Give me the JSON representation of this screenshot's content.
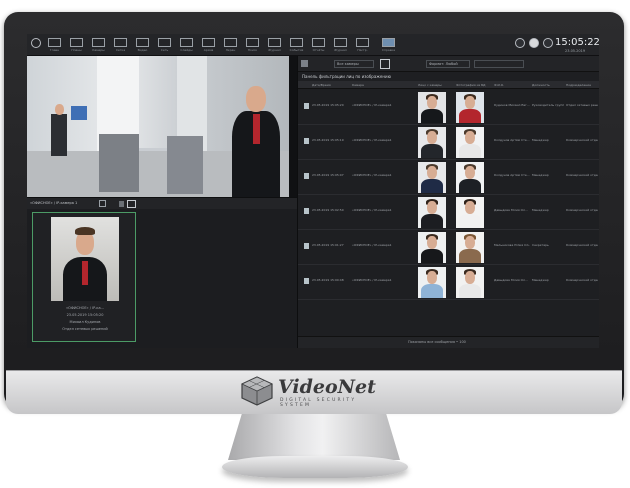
{
  "toolbar": {
    "buttons": [
      "Главн",
      "Планы",
      "Камеры",
      "Сетка",
      "Видео",
      "Сеть",
      "Слайды",
      "Архив",
      "Экран",
      "Поиск",
      "Журнал",
      "События",
      "Отчёты",
      "Журнал",
      "Настр.",
      "Справка"
    ],
    "clock": "15:05:22",
    "date": "23.05.2019"
  },
  "camera2": {
    "label": "«ОФИСНОЕ» / IP-камера 1"
  },
  "snapshot": {
    "caption": "«ОФИСНОЕ» / IP-ка...",
    "time": "23.05.2019 15:05:20",
    "name": "Михаил Кудинов",
    "dept": "Отдел сетевых решений"
  },
  "panel": {
    "cameras_field": "Все камеры",
    "format_field": "Формат: Любой",
    "title": "Панель фильтрации лиц по изображению",
    "columns": [
      "Дата/Время",
      "Камера",
      "Лицо с камеры",
      "Фотография из БД",
      "Ф.И.О.",
      "Должность",
      "Подразделение"
    ],
    "rows": [
      {
        "time": "23.05.2019 15:05:20",
        "camera": "«ОФИСНОЕ» / IP-камера1",
        "name": "Кудинов Михаил Евг...",
        "position": "Руководитель группы",
        "dept": "Отдел сетевых решений"
      },
      {
        "time": "23.05.2019 15:05:19",
        "camera": "«ОФИСНОЕ» / IP-камера1",
        "name": "Колдунов Артём Сте...",
        "position": "Менеджер",
        "dept": "Коммерческий отдел"
      },
      {
        "time": "23.05.2019 15:05:07",
        "camera": "«ОФИСНОЕ» / IP-камера1",
        "name": "Колдунов Артём Сте...",
        "position": "Менеджер",
        "dept": "Коммерческий отдел"
      },
      {
        "time": "23.05.2019 15:02:50",
        "camera": "«ОФИСНОЕ» / IP-камера1",
        "name": "Давыдова Юлия Ол...",
        "position": "Менеджер",
        "dept": "Коммерческий отдел"
      },
      {
        "time": "23.05.2019 15:01:27",
        "camera": "«ОФИСНОЕ» / IP-камера1",
        "name": "Мельникова Юлия Ол...",
        "position": "Секретарь",
        "dept": "Коммерческий отдел"
      },
      {
        "time": "23.05.2019 15:00:48",
        "camera": "«ОФИСНОЕ» / IP-камера1",
        "name": "Давыдова Юлия Ол...",
        "position": "Менеджер",
        "dept": "Коммерческий отдел"
      }
    ],
    "footer": "Показаны все сообщения  •  100"
  },
  "brand": {
    "name": "VideoNet",
    "tagline": "DIGITAL SECURITY SYSTEM"
  },
  "colors": {
    "accent_green": "#4c9b66",
    "screen_bg": "#1a1b1d"
  }
}
